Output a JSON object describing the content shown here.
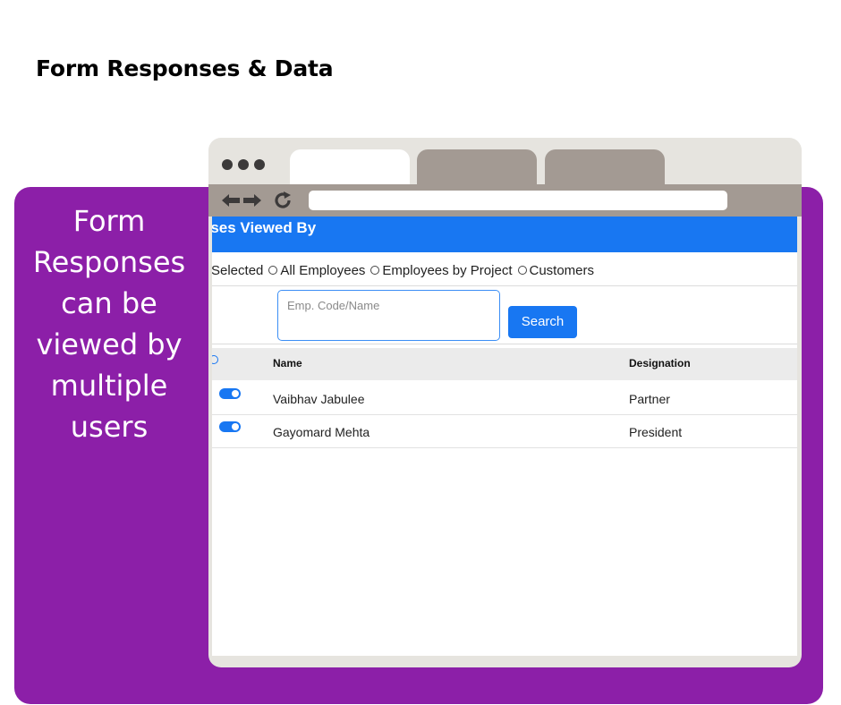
{
  "page": {
    "title": "Form Responses & Data"
  },
  "promo": {
    "text": "Form Responses can be viewed by multiple users"
  },
  "colors": {
    "accent": "#1877f2",
    "panel": "#8c1fa8",
    "browser_chrome": "#a39a93"
  },
  "browser": {
    "icons": [
      "back-arrow-icon",
      "forward-arrow-icon",
      "reload-icon"
    ]
  },
  "app": {
    "header_title": "Responses Viewed By",
    "radio_options": [
      {
        "label": "Selected"
      },
      {
        "label": "All Employees"
      },
      {
        "label": "Employees by Project"
      },
      {
        "label": "Customers"
      }
    ],
    "search": {
      "placeholder": "Emp. Code/Name",
      "button_label": "Search"
    },
    "table": {
      "columns": [
        "Name",
        "Designation"
      ],
      "rows": [
        {
          "name": "Vaibhav Jabulee",
          "designation": "Partner",
          "enabled": true
        },
        {
          "name": "Gayomard Mehta",
          "designation": "President",
          "enabled": true
        }
      ]
    }
  }
}
